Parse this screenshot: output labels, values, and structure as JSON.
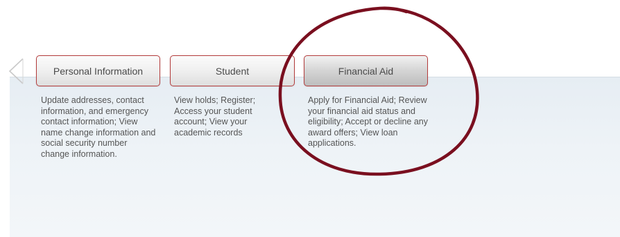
{
  "tabs": [
    {
      "label": "Personal Information",
      "description": "Update addresses, contact information, and emergency contact information; View name change information and social security number change information.",
      "active": false
    },
    {
      "label": "Student",
      "description": "View holds; Register; Access your student account; View your academic records",
      "active": false
    },
    {
      "label": "Financial Aid",
      "description": "Apply for Financial Aid; Review your financial aid status and eligibility; Accept or decline any award offers; View loan applications.",
      "active": true
    }
  ],
  "colors": {
    "tab_border": "#b33b3b",
    "annotation_circle": "#7a0f1f",
    "panel_background": "#e6edf3",
    "text": "#555555"
  },
  "icons": {
    "left_arrow": "chevron-left-icon"
  }
}
